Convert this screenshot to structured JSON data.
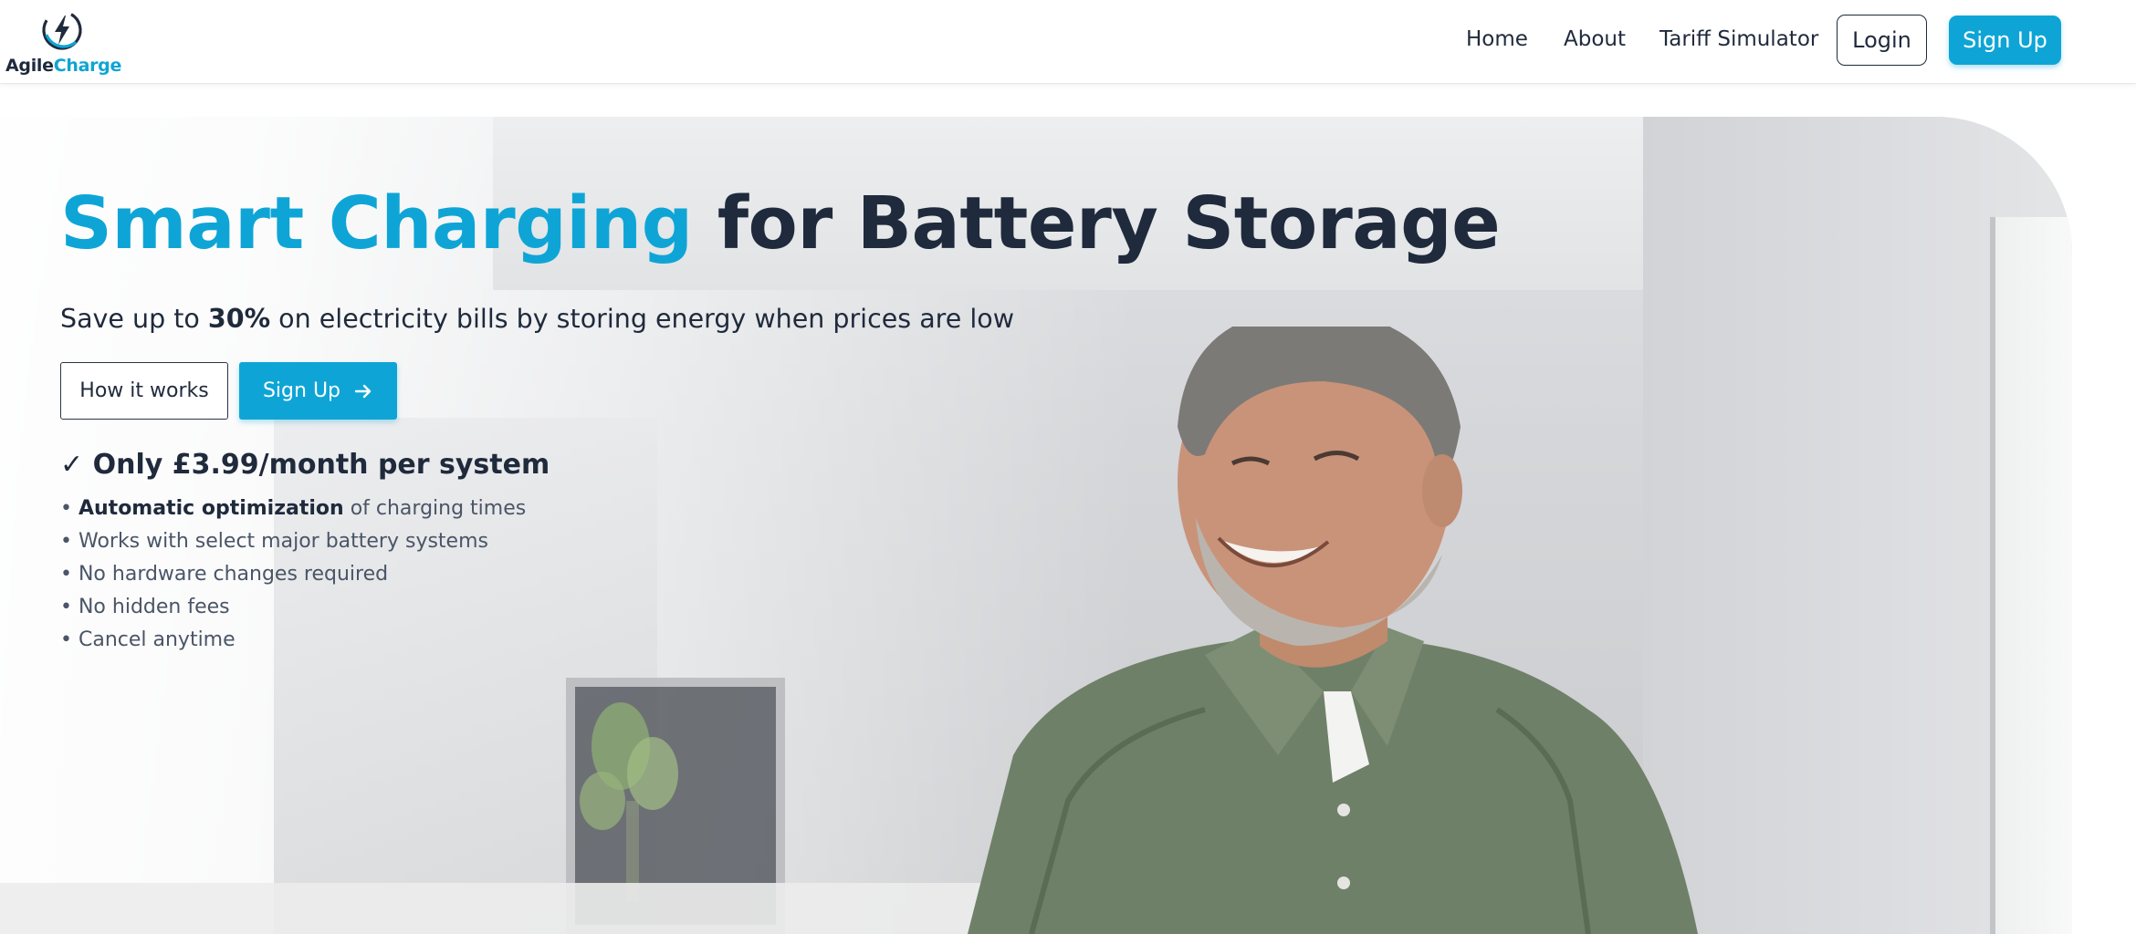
{
  "brand": {
    "name_part1": "Agile",
    "name_part2": "Charge",
    "accent_color": "#0ea5d6",
    "text_color": "#1f2a3c",
    "logo_icon": "lightning-bolt-icon"
  },
  "nav": {
    "links": [
      {
        "label": "Home"
      },
      {
        "label": "About"
      },
      {
        "label": "Tariff Simulator"
      }
    ],
    "login_label": "Login",
    "signup_label": "Sign Up"
  },
  "hero": {
    "title_accent": "Smart Charging",
    "title_rest": "for Battery Storage",
    "subtitle_pre": "Save up to ",
    "subtitle_bold": "30%",
    "subtitle_post": " on electricity bills by storing energy when prices are low",
    "how_label": "How it works",
    "signup_label": "Sign Up",
    "signup_icon": "arrow-right-icon",
    "price_check": "✓",
    "price_text": "Only £3.99/month per system",
    "features": [
      {
        "bullet": "•",
        "bold": "Automatic optimization",
        "text": " of charging times"
      },
      {
        "bullet": "•",
        "bold": "",
        "text": " Works with select major battery systems"
      },
      {
        "bullet": "•",
        "bold": "",
        "text": " No hardware changes required"
      },
      {
        "bullet": "•",
        "bold": "",
        "text": " No hidden fees"
      },
      {
        "bullet": "•",
        "bold": "",
        "text": " Cancel anytime"
      }
    ],
    "image_subject": "smiling-man-in-kitchen-photo"
  }
}
